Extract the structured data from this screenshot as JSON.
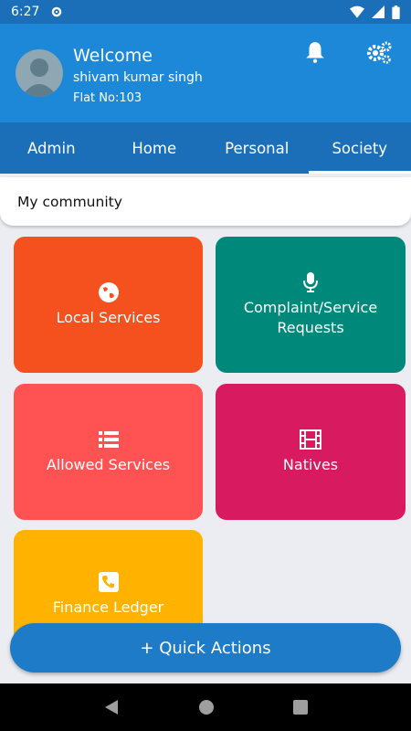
{
  "status_bar": {
    "time": "6:27"
  },
  "header": {
    "welcome": "Welcome",
    "user_name": "shivam kumar singh",
    "flat": "Flat No:103"
  },
  "tabs": [
    {
      "label": "Admin",
      "active": false
    },
    {
      "label": "Home",
      "active": false
    },
    {
      "label": "Personal",
      "active": false
    },
    {
      "label": "Society",
      "active": true
    }
  ],
  "community": {
    "label": "My community"
  },
  "tiles": [
    {
      "label": "Local Services",
      "icon": "globe-icon",
      "color": "#f4511e"
    },
    {
      "label": "Complaint/Service Requests",
      "icon": "microphone-icon",
      "color": "#00897b"
    },
    {
      "label": "Allowed Services",
      "icon": "list-icon",
      "color": "#ff5252"
    },
    {
      "label": "Natives",
      "icon": "film-icon",
      "color": "#d81b60"
    },
    {
      "label": "Finance Ledger",
      "icon": "phone-icon",
      "color": "#ffb300"
    }
  ],
  "quick_actions": {
    "label": "+ Quick Actions"
  },
  "colors": {
    "header": "#1e88d8",
    "tab_bar": "#1b6fb8",
    "quick_action": "#1e7bc8"
  }
}
